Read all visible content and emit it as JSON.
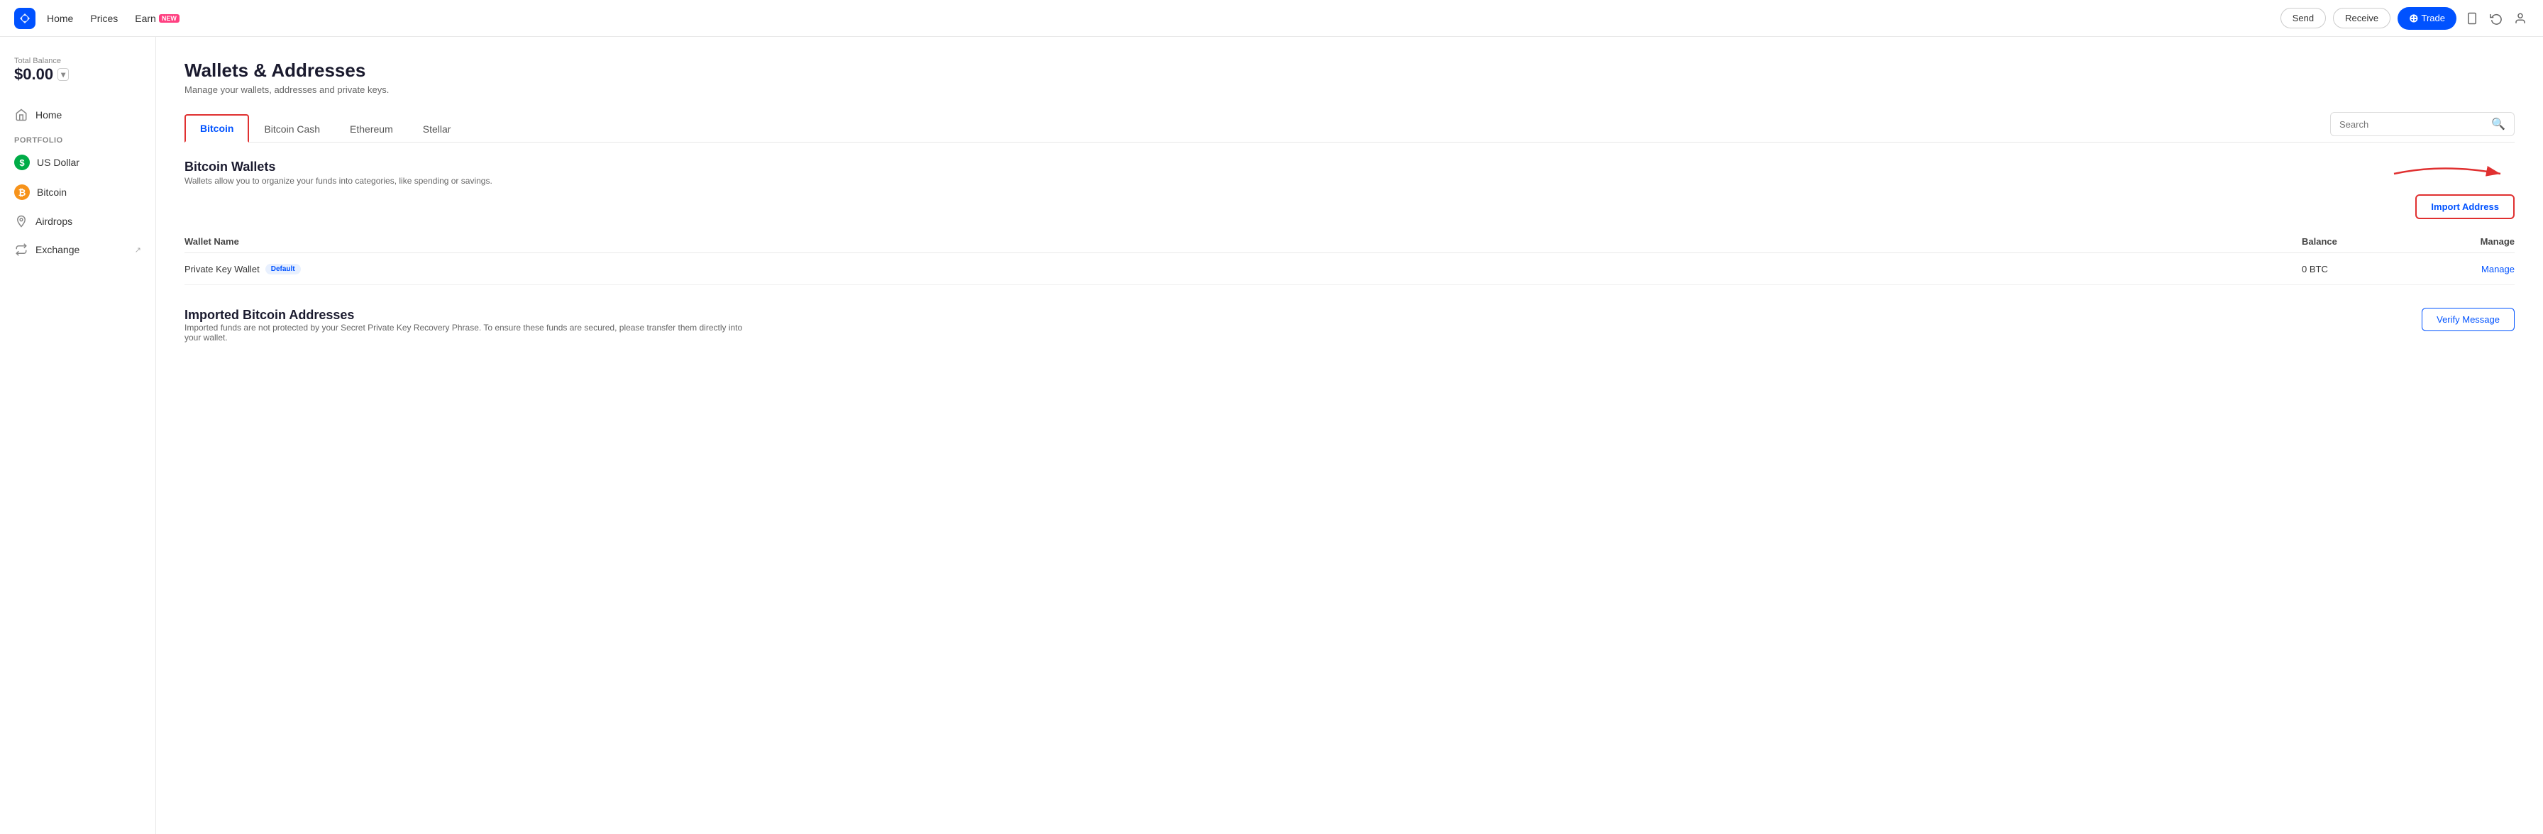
{
  "topnav": {
    "home_label": "Home",
    "prices_label": "Prices",
    "earn_label": "Earn",
    "earn_badge": "NEW",
    "send_label": "Send",
    "receive_label": "Receive",
    "trade_label": "Trade"
  },
  "sidebar": {
    "balance_label": "Total Balance",
    "balance_amount": "$0.00",
    "portfolio_label": "Portfolio",
    "nav_items": [
      {
        "id": "home",
        "label": "Home"
      },
      {
        "id": "usd",
        "label": "US Dollar"
      },
      {
        "id": "btc",
        "label": "Bitcoin"
      },
      {
        "id": "airdrops",
        "label": "Airdrops"
      },
      {
        "id": "exchange",
        "label": "Exchange"
      }
    ]
  },
  "page": {
    "title": "Wallets & Addresses",
    "subtitle": "Manage your wallets, addresses and private keys.",
    "tabs": [
      {
        "id": "bitcoin",
        "label": "Bitcoin",
        "active": true
      },
      {
        "id": "bitcoin-cash",
        "label": "Bitcoin Cash"
      },
      {
        "id": "ethereum",
        "label": "Ethereum"
      },
      {
        "id": "stellar",
        "label": "Stellar"
      }
    ],
    "search_placeholder": "Search",
    "import_address_label": "Import Address",
    "wallets_section": {
      "title": "Bitcoin Wallets",
      "description": "Wallets allow you to organize your funds into categories, like spending or savings.",
      "columns": {
        "wallet_name": "Wallet Name",
        "balance": "Balance",
        "manage": "Manage"
      },
      "rows": [
        {
          "name": "Private Key Wallet",
          "badge": "Default",
          "balance": "0 BTC",
          "manage": "Manage"
        }
      ]
    },
    "imported_section": {
      "title": "Imported Bitcoin Addresses",
      "description": "Imported funds are not protected by your Secret Private Key Recovery Phrase. To ensure these funds are secured, please transfer them directly into your wallet.",
      "verify_label": "Verify Message"
    }
  }
}
